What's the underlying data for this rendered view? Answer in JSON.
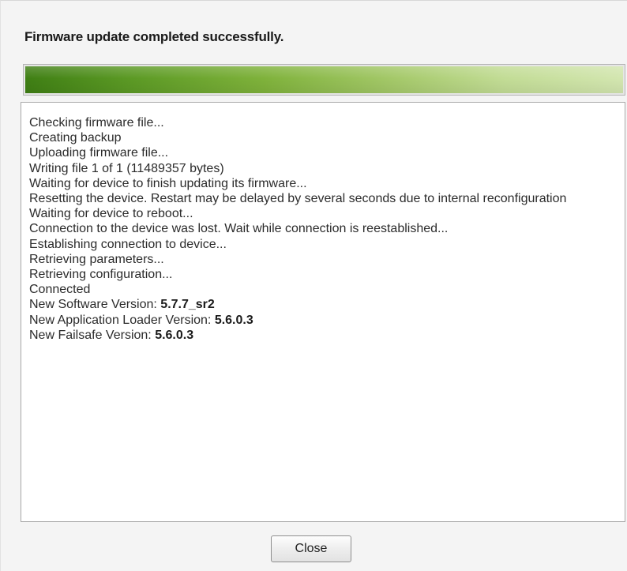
{
  "dialog": {
    "title": "Firmware update completed successfully.",
    "progress": {
      "percent": 100
    },
    "log": {
      "lines": [
        "Checking firmware file...",
        "Creating backup",
        "Uploading firmware file...",
        "Writing file 1 of 1 (11489357 bytes)",
        "Waiting for device to finish updating its firmware...",
        "Resetting the device. Restart may be delayed by several seconds due to internal reconfiguration",
        "Waiting for device to reboot...",
        "Connection to the device was lost. Wait while connection is reestablished...",
        "Establishing connection to device...",
        "Retrieving parameters...",
        "Retrieving configuration...",
        "Connected"
      ],
      "versions": {
        "software_label": "New Software Version: ",
        "software_value": "5.7.7_sr2",
        "app_loader_label": "New Application Loader Version: ",
        "app_loader_value": "5.6.0.3",
        "failsafe_label": "New Failsafe Version: ",
        "failsafe_value": "5.6.0.3"
      }
    },
    "close_label": "Close"
  }
}
